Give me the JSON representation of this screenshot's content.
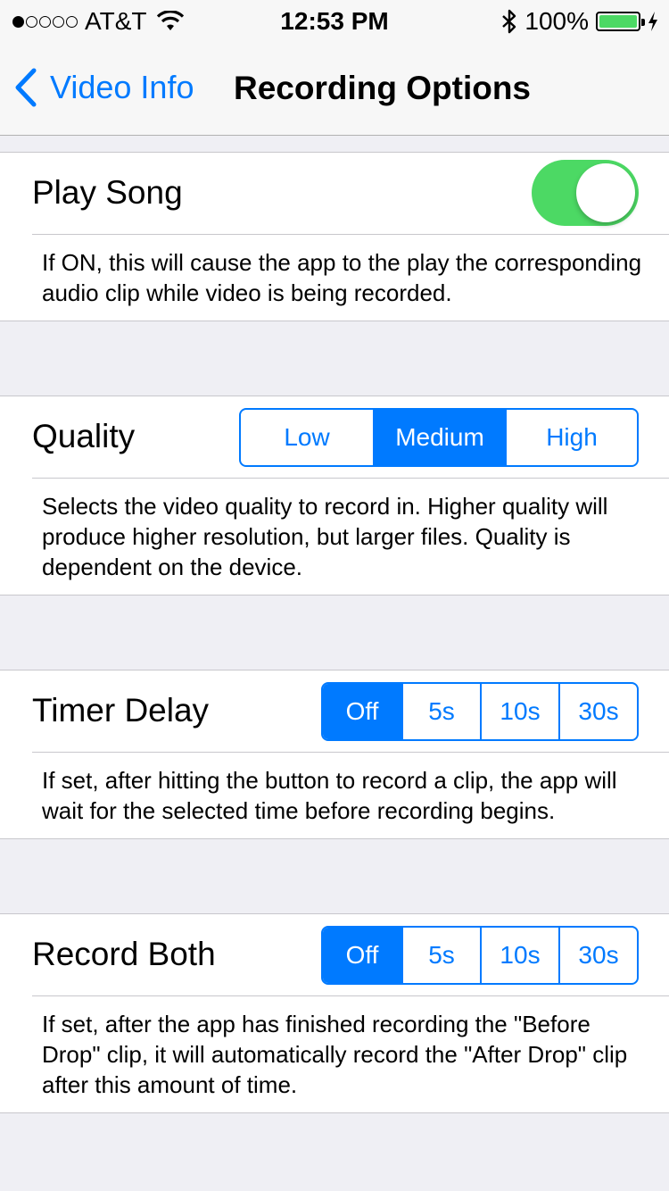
{
  "status_bar": {
    "carrier": "AT&T",
    "signal_bars_filled": 1,
    "signal_bars_total": 5,
    "time": "12:53 PM",
    "battery": "100%"
  },
  "nav": {
    "back_label": "Video Info",
    "title": "Recording Options"
  },
  "play_song": {
    "label": "Play Song",
    "on": true,
    "description": "If ON, this will cause the app to the play the corresponding audio clip while video is being recorded."
  },
  "quality": {
    "label": "Quality",
    "options": [
      "Low",
      "Medium",
      "High"
    ],
    "selected": "Medium",
    "description": "Selects the video quality to record in.  Higher quality will produce higher resolution, but larger files.  Quality is dependent on the device."
  },
  "timer_delay": {
    "label": "Timer Delay",
    "options": [
      "Off",
      "5s",
      "10s",
      "30s"
    ],
    "selected": "Off",
    "description": "If set, after hitting the button to record a clip, the app will wait for the selected time before recording begins."
  },
  "record_both": {
    "label": "Record Both",
    "options": [
      "Off",
      "5s",
      "10s",
      "30s"
    ],
    "selected": "Off",
    "description": "If set, after the app has finished recording the \"Before Drop\" clip, it will automatically record the \"After Drop\" clip after this amount of time."
  },
  "colors": {
    "accent": "#007aff",
    "toggle_on": "#4cd964",
    "battery": "#4cd964"
  }
}
